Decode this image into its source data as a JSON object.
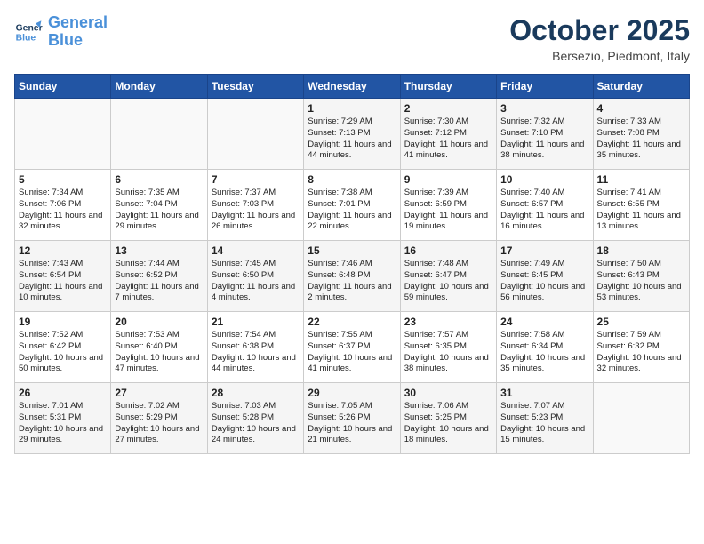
{
  "header": {
    "logo_line1": "General",
    "logo_line2": "Blue",
    "month": "October 2025",
    "location": "Bersezio, Piedmont, Italy"
  },
  "days_of_week": [
    "Sunday",
    "Monday",
    "Tuesday",
    "Wednesday",
    "Thursday",
    "Friday",
    "Saturday"
  ],
  "weeks": [
    [
      {
        "day": "",
        "text": ""
      },
      {
        "day": "",
        "text": ""
      },
      {
        "day": "",
        "text": ""
      },
      {
        "day": "1",
        "text": "Sunrise: 7:29 AM\nSunset: 7:13 PM\nDaylight: 11 hours and 44 minutes."
      },
      {
        "day": "2",
        "text": "Sunrise: 7:30 AM\nSunset: 7:12 PM\nDaylight: 11 hours and 41 minutes."
      },
      {
        "day": "3",
        "text": "Sunrise: 7:32 AM\nSunset: 7:10 PM\nDaylight: 11 hours and 38 minutes."
      },
      {
        "day": "4",
        "text": "Sunrise: 7:33 AM\nSunset: 7:08 PM\nDaylight: 11 hours and 35 minutes."
      }
    ],
    [
      {
        "day": "5",
        "text": "Sunrise: 7:34 AM\nSunset: 7:06 PM\nDaylight: 11 hours and 32 minutes."
      },
      {
        "day": "6",
        "text": "Sunrise: 7:35 AM\nSunset: 7:04 PM\nDaylight: 11 hours and 29 minutes."
      },
      {
        "day": "7",
        "text": "Sunrise: 7:37 AM\nSunset: 7:03 PM\nDaylight: 11 hours and 26 minutes."
      },
      {
        "day": "8",
        "text": "Sunrise: 7:38 AM\nSunset: 7:01 PM\nDaylight: 11 hours and 22 minutes."
      },
      {
        "day": "9",
        "text": "Sunrise: 7:39 AM\nSunset: 6:59 PM\nDaylight: 11 hours and 19 minutes."
      },
      {
        "day": "10",
        "text": "Sunrise: 7:40 AM\nSunset: 6:57 PM\nDaylight: 11 hours and 16 minutes."
      },
      {
        "day": "11",
        "text": "Sunrise: 7:41 AM\nSunset: 6:55 PM\nDaylight: 11 hours and 13 minutes."
      }
    ],
    [
      {
        "day": "12",
        "text": "Sunrise: 7:43 AM\nSunset: 6:54 PM\nDaylight: 11 hours and 10 minutes."
      },
      {
        "day": "13",
        "text": "Sunrise: 7:44 AM\nSunset: 6:52 PM\nDaylight: 11 hours and 7 minutes."
      },
      {
        "day": "14",
        "text": "Sunrise: 7:45 AM\nSunset: 6:50 PM\nDaylight: 11 hours and 4 minutes."
      },
      {
        "day": "15",
        "text": "Sunrise: 7:46 AM\nSunset: 6:48 PM\nDaylight: 11 hours and 2 minutes."
      },
      {
        "day": "16",
        "text": "Sunrise: 7:48 AM\nSunset: 6:47 PM\nDaylight: 10 hours and 59 minutes."
      },
      {
        "day": "17",
        "text": "Sunrise: 7:49 AM\nSunset: 6:45 PM\nDaylight: 10 hours and 56 minutes."
      },
      {
        "day": "18",
        "text": "Sunrise: 7:50 AM\nSunset: 6:43 PM\nDaylight: 10 hours and 53 minutes."
      }
    ],
    [
      {
        "day": "19",
        "text": "Sunrise: 7:52 AM\nSunset: 6:42 PM\nDaylight: 10 hours and 50 minutes."
      },
      {
        "day": "20",
        "text": "Sunrise: 7:53 AM\nSunset: 6:40 PM\nDaylight: 10 hours and 47 minutes."
      },
      {
        "day": "21",
        "text": "Sunrise: 7:54 AM\nSunset: 6:38 PM\nDaylight: 10 hours and 44 minutes."
      },
      {
        "day": "22",
        "text": "Sunrise: 7:55 AM\nSunset: 6:37 PM\nDaylight: 10 hours and 41 minutes."
      },
      {
        "day": "23",
        "text": "Sunrise: 7:57 AM\nSunset: 6:35 PM\nDaylight: 10 hours and 38 minutes."
      },
      {
        "day": "24",
        "text": "Sunrise: 7:58 AM\nSunset: 6:34 PM\nDaylight: 10 hours and 35 minutes."
      },
      {
        "day": "25",
        "text": "Sunrise: 7:59 AM\nSunset: 6:32 PM\nDaylight: 10 hours and 32 minutes."
      }
    ],
    [
      {
        "day": "26",
        "text": "Sunrise: 7:01 AM\nSunset: 5:31 PM\nDaylight: 10 hours and 29 minutes."
      },
      {
        "day": "27",
        "text": "Sunrise: 7:02 AM\nSunset: 5:29 PM\nDaylight: 10 hours and 27 minutes."
      },
      {
        "day": "28",
        "text": "Sunrise: 7:03 AM\nSunset: 5:28 PM\nDaylight: 10 hours and 24 minutes."
      },
      {
        "day": "29",
        "text": "Sunrise: 7:05 AM\nSunset: 5:26 PM\nDaylight: 10 hours and 21 minutes."
      },
      {
        "day": "30",
        "text": "Sunrise: 7:06 AM\nSunset: 5:25 PM\nDaylight: 10 hours and 18 minutes."
      },
      {
        "day": "31",
        "text": "Sunrise: 7:07 AM\nSunset: 5:23 PM\nDaylight: 10 hours and 15 minutes."
      },
      {
        "day": "",
        "text": ""
      }
    ]
  ]
}
